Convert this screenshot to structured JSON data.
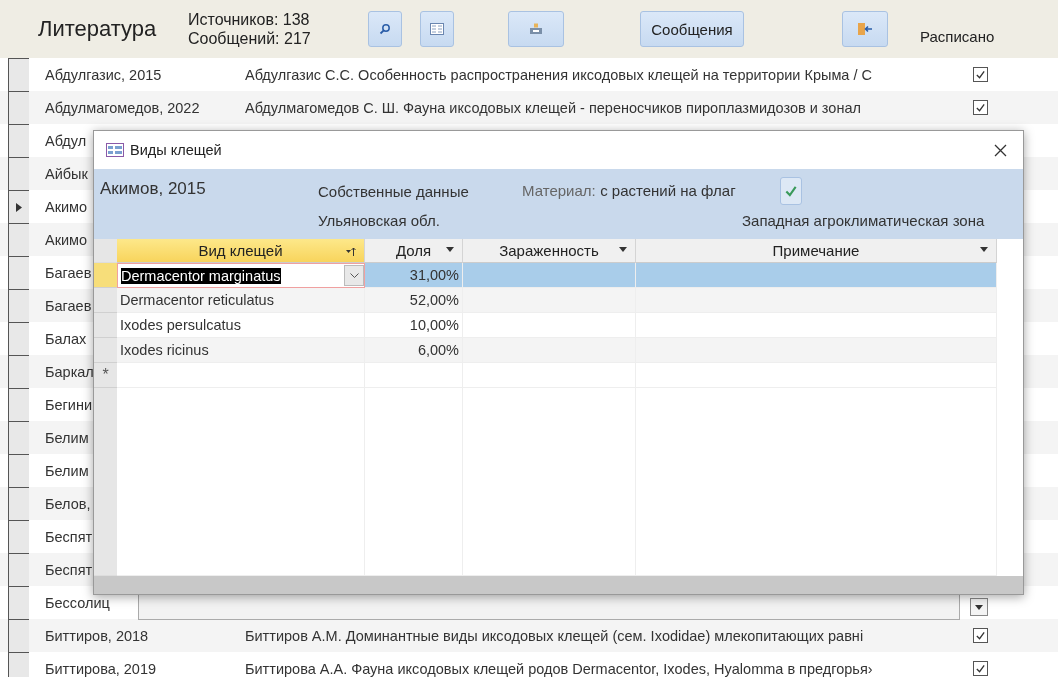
{
  "header": {
    "title": "Литература",
    "counts": [
      "Источников: 138",
      "Сообщений: 217"
    ],
    "messages_button": "Сообщения",
    "column_label": "Расписано"
  },
  "records": [
    {
      "author": "Абдулгазис, 2015",
      "description": "Абдулгазис С.С. Особенность распространения иксодовых клещей на территории Крыма / С",
      "scheduled": true,
      "selected": false
    },
    {
      "author": "Абдулмагомедов, 2022",
      "description": "Абдулмагомедов С. Ш. Фауна иксодовых клещей - переносчиков пироплазмидозов и зонал",
      "scheduled": true,
      "selected": false
    },
    {
      "author": "Абдул",
      "selected": false
    },
    {
      "author": "Айбык",
      "selected": false
    },
    {
      "author": "Акимо",
      "selected": true
    },
    {
      "author": "Акимо",
      "selected": false
    },
    {
      "author": "Багаев",
      "selected": false
    },
    {
      "author": "Багаев",
      "selected": false
    },
    {
      "author": "Балах",
      "selected": false
    },
    {
      "author": "Баркал",
      "selected": false
    },
    {
      "author": "Бегини",
      "selected": false
    },
    {
      "author": "Белим",
      "selected": false
    },
    {
      "author": "Белим",
      "selected": false
    },
    {
      "author": "Белов,",
      "selected": false
    },
    {
      "author": "Беспят",
      "selected": false
    },
    {
      "author": "Беспят",
      "selected": false
    },
    {
      "author": "Бессолиц",
      "selected": false
    },
    {
      "author": "Биттиров, 2018",
      "description": "Биттиров А.М. Доминантные виды иксодовых клещей (сем. Ixodidae) млекопитающих равні",
      "scheduled": true,
      "selected": false
    },
    {
      "author": "Биттирова, 2019",
      "description": "Биттирова А.А. Фауна иксодовых клещей родов Dermacentor, Ixodes, Hyalomma в предгорья›",
      "scheduled": true,
      "selected": false
    }
  ],
  "dialog": {
    "title": "Виды клещей",
    "source": "Акимов, 2015",
    "data_type": "Собственные данные",
    "region": "Ульяновская обл.",
    "material_label": "Материал:",
    "material": "с растений на флаг",
    "zone": "Западная агроклиматическая зона",
    "columns": [
      {
        "label": "Вид клещей",
        "selected": true,
        "sorted": true
      },
      {
        "label": "Доля",
        "selected": false,
        "sorted": false
      },
      {
        "label": "Зараженность",
        "selected": false,
        "sorted": false
      },
      {
        "label": "Примечание",
        "selected": false,
        "sorted": false
      }
    ],
    "rows": [
      {
        "species": "Dermacentor marginatus",
        "share": "31,00%",
        "selected": true
      },
      {
        "species": "Dermacentor reticulatus",
        "share": "52,00%",
        "selected": false
      },
      {
        "species": "Ixodes persulcatus",
        "share": "10,00%",
        "selected": false
      },
      {
        "species": "Ixodes ricinus",
        "share": "6,00%",
        "selected": false
      }
    ],
    "new_row_marker": "*"
  }
}
